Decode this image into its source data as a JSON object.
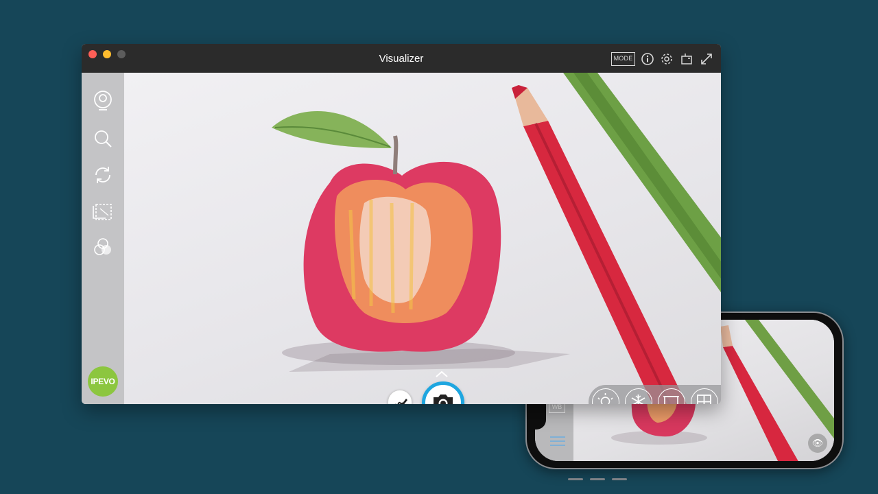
{
  "window": {
    "title": "Visualizer",
    "mode_label": "MODE"
  },
  "sidebar": {
    "items": [
      {
        "icon": "webcam-icon"
      },
      {
        "icon": "zoom-icon"
      },
      {
        "icon": "rotate-icon"
      },
      {
        "icon": "crop-icon"
      },
      {
        "icon": "adjust-icon"
      }
    ],
    "brand": "IPEVO"
  },
  "toolbar": {
    "icons": [
      "info-icon",
      "gear-icon",
      "layout-icon",
      "fullscreen-icon"
    ]
  },
  "bottom_tools": [
    "light-icon",
    "freeze-icon",
    "presentation-icon",
    "split-icon",
    "focus-icon"
  ],
  "phone": {
    "wb_label": "WB"
  },
  "colors": {
    "background": "#164658",
    "titlebar": "#2b2b2b",
    "capture_ring": "#1ea6e0",
    "brand_green": "#8cc63f"
  }
}
